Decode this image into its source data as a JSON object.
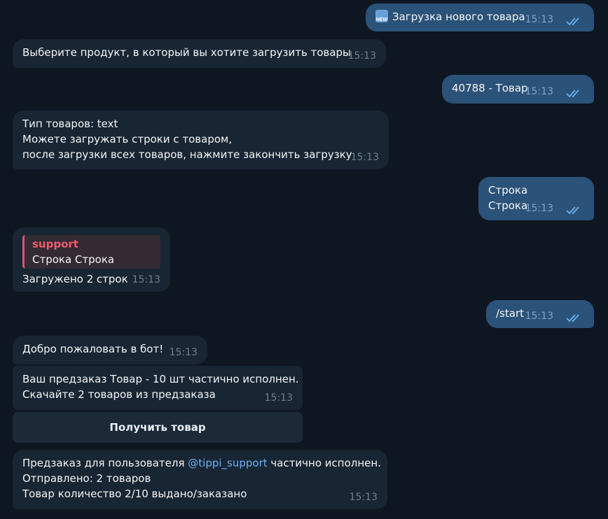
{
  "colors": {
    "background": "#0e1621",
    "incoming_bubble": "#182533",
    "outgoing_bubble": "#2b5278",
    "mention": "#6ab2f2",
    "quote_author": "#ef5b6b",
    "checks": "#6ab2f2"
  },
  "messages": [
    {
      "direction": "out",
      "icon": "new-emoji-icon",
      "icon_text": "NEW",
      "text": "Загрузка нового товара",
      "time": "15:13",
      "status": "read-double-check-icon"
    },
    {
      "direction": "in",
      "text": "Выберите продукт, в который вы хотите загрузить товары",
      "time": "15:13"
    },
    {
      "direction": "out",
      "text": "40788 - Товар",
      "time": "15:13",
      "status": "read-double-check-icon"
    },
    {
      "direction": "in",
      "lines": [
        "Тип товаров: text",
        "Можете загружать строки с товаром,",
        "после загрузки всех товаров, нажмите закончить загрузку"
      ],
      "time": "15:13"
    },
    {
      "direction": "out",
      "lines": [
        "Строка",
        "Строка"
      ],
      "time": "15:13",
      "status": "read-double-check-icon"
    },
    {
      "direction": "in",
      "quote": {
        "author": "support",
        "text": "Строка Строка"
      },
      "text": "Загружено 2 строк",
      "time": "15:13"
    },
    {
      "direction": "out",
      "text": "/start",
      "time": "15:13",
      "status": "read-double-check-icon"
    },
    {
      "direction": "in",
      "text": "Добро пожаловать в бот!",
      "time": "15:13"
    },
    {
      "direction": "in",
      "lines": [
        "Ваш предзаказ Товар - 10 шт частично исполнен.",
        "Скачайте 2 товаров из предзаказа"
      ],
      "time": "15:13",
      "button": "Получить товар"
    },
    {
      "direction": "in",
      "line1_prefix": "Предзаказ для пользователя ",
      "mention": "@tippi_support",
      "line1_suffix": " частично исполнен.",
      "lines": [
        "Отправлено: 2 товаров",
        "Товар количество 2/10 выдано/заказано"
      ],
      "time": "15:13"
    }
  ]
}
